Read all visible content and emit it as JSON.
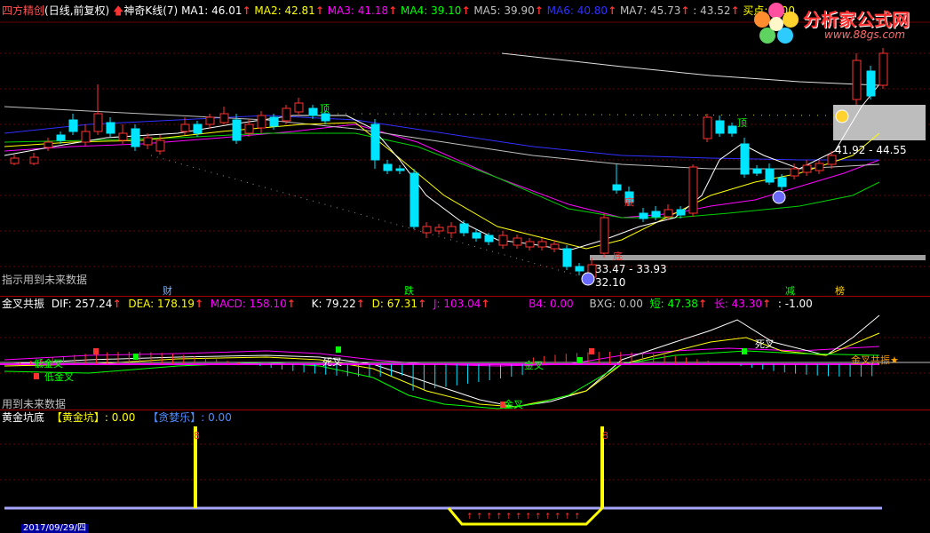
{
  "colors": {
    "bg": "#000000",
    "up": "#ff3232",
    "down": "#00e5ff",
    "grid": "#8b0000"
  },
  "main": {
    "source": "四方精创",
    "period": "(日线,前复权)",
    "indicator": "神奇K线(7)",
    "ma": [
      {
        "name": "MA1: 46.01",
        "color": "#ffffff"
      },
      {
        "name": "MA2: 42.81",
        "color": "#ffff00"
      },
      {
        "name": "MA3: 41.18",
        "color": "#ff00ff"
      },
      {
        "name": "MA4: 39.10",
        "color": "#00ff00"
      },
      {
        "name": "MA5: 39.90",
        "color": "#c0c0c0"
      },
      {
        "name": "MA6: 40.80",
        "color": "#3030ff"
      },
      {
        "name": "MA7: 45.73",
        "color": "#c0c0c0"
      },
      {
        "name": ": 43.52",
        "color": "#c0c0c0"
      },
      {
        "name": "买点: 0.00",
        "color": "#ffff00"
      }
    ],
    "note_future": "指示用到未来数据",
    "range_high": "41.92 - 44.55",
    "range_low": "33.47 - 33.93",
    "low_price": "32.10",
    "lbl_top1": "顶",
    "lbl_top2": "顶",
    "lbl_bottom1": "底",
    "lbl_bottom2": "底",
    "tag_cai": "财",
    "tag_die": "跌",
    "tag_jian": "减",
    "tag_bang": "榜"
  },
  "logo": {
    "text": "分析家公式网",
    "url": "www.88gs.com"
  },
  "macd": {
    "title": "金叉共振",
    "dif": "DIF: 257.24",
    "dea": "DEA: 178.19",
    "macd": "MACD: 158.10",
    "k": "K: 79.22",
    "d": "D: 67.31",
    "j": "J: 103.04",
    "b4": "B4: 0.00",
    "bxg": "BXG: 0.00",
    "short": "短: 47.38",
    "long": "长: 43.30",
    "last": ": -1.00",
    "note_future": "用到未来数据",
    "gold1": "低金叉",
    "gold2": "低金叉",
    "gold3": "金叉",
    "gold4": "金叉",
    "dead1": "死叉",
    "dead2": "死叉",
    "resonance": "金叉共振"
  },
  "pit": {
    "title": "黄金坑底",
    "pit_label": "【黄金坑】: 0.00",
    "greedy_label": "【贪婪乐】: 0.00",
    "mark1": "8",
    "mark2": "8"
  },
  "footer": {
    "date": "2017/09/29/四"
  }
}
